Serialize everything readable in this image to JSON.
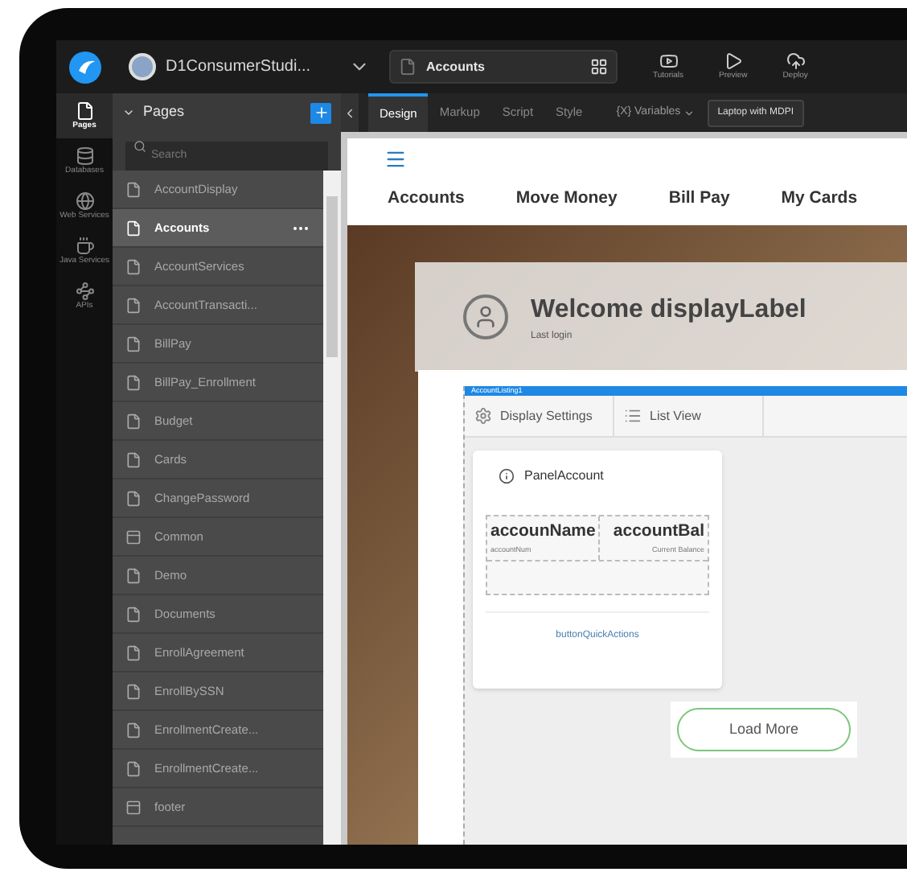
{
  "top_bar": {
    "project": "D1ConsumerStudi...",
    "page_selector": "Accounts",
    "actions": [
      {
        "label": "Tutorials",
        "kind": "video"
      },
      {
        "label": "Preview",
        "kind": "play"
      },
      {
        "label": "Deploy",
        "kind": "cloud"
      }
    ]
  },
  "rail": [
    {
      "label": "Pages",
      "kind": "pages",
      "selected": true
    },
    {
      "label": "Databases",
      "kind": "database",
      "selected": false
    },
    {
      "label": "Web Services",
      "kind": "web",
      "selected": false
    },
    {
      "label": "Java Services",
      "kind": "java",
      "selected": false
    },
    {
      "label": "APIs",
      "kind": "api",
      "selected": false
    }
  ],
  "pages_panel": {
    "title": "Pages",
    "search_placeholder": "Search",
    "items": [
      {
        "label": "AccountDisplay",
        "kind": "page",
        "selected": false
      },
      {
        "label": "Accounts",
        "kind": "page",
        "selected": true
      },
      {
        "label": "AccountServices",
        "kind": "page",
        "selected": false
      },
      {
        "label": "AccountTransacti...",
        "kind": "page",
        "selected": false
      },
      {
        "label": "BillPay",
        "kind": "page",
        "selected": false
      },
      {
        "label": "BillPay_Enrollment",
        "kind": "page",
        "selected": false
      },
      {
        "label": "Budget",
        "kind": "page",
        "selected": false
      },
      {
        "label": "Cards",
        "kind": "page",
        "selected": false
      },
      {
        "label": "ChangePassword",
        "kind": "page",
        "selected": false
      },
      {
        "label": "Common",
        "kind": "partial",
        "selected": false
      },
      {
        "label": "Demo",
        "kind": "page",
        "selected": false
      },
      {
        "label": "Documents",
        "kind": "page",
        "selected": false
      },
      {
        "label": "EnrollAgreement",
        "kind": "page",
        "selected": false
      },
      {
        "label": "EnrollBySSN",
        "kind": "page",
        "selected": false
      },
      {
        "label": "EnrollmentCreate...",
        "kind": "page",
        "selected": false
      },
      {
        "label": "EnrollmentCreate...",
        "kind": "page",
        "selected": false
      },
      {
        "label": "footer",
        "kind": "partial",
        "selected": false
      }
    ]
  },
  "editor_tabs": [
    {
      "label": "Design",
      "selected": true
    },
    {
      "label": "Markup",
      "selected": false
    },
    {
      "label": "Script",
      "selected": false
    },
    {
      "label": "Style",
      "selected": false
    }
  ],
  "variables": "{X} Variables",
  "device": "Laptop with MDPI",
  "canvas": {
    "nav": [
      "Accounts",
      "Move Money",
      "Bill Pay",
      "My Cards"
    ],
    "welcome": "Welcome displayLabel",
    "last_login": "Last login",
    "widget_label": "AccountListing1",
    "widget_tabs": [
      {
        "label": "Display Settings",
        "kind": "settings"
      },
      {
        "label": "List View",
        "kind": "list"
      }
    ],
    "panel_title": "PanelAccount",
    "columns": [
      {
        "title": "accounName",
        "subtitle": "accountNum"
      },
      {
        "title": "accountBal",
        "subtitle": "Current Balance"
      }
    ],
    "quick_actions": "buttonQuickActions",
    "load_more": "Load More"
  }
}
